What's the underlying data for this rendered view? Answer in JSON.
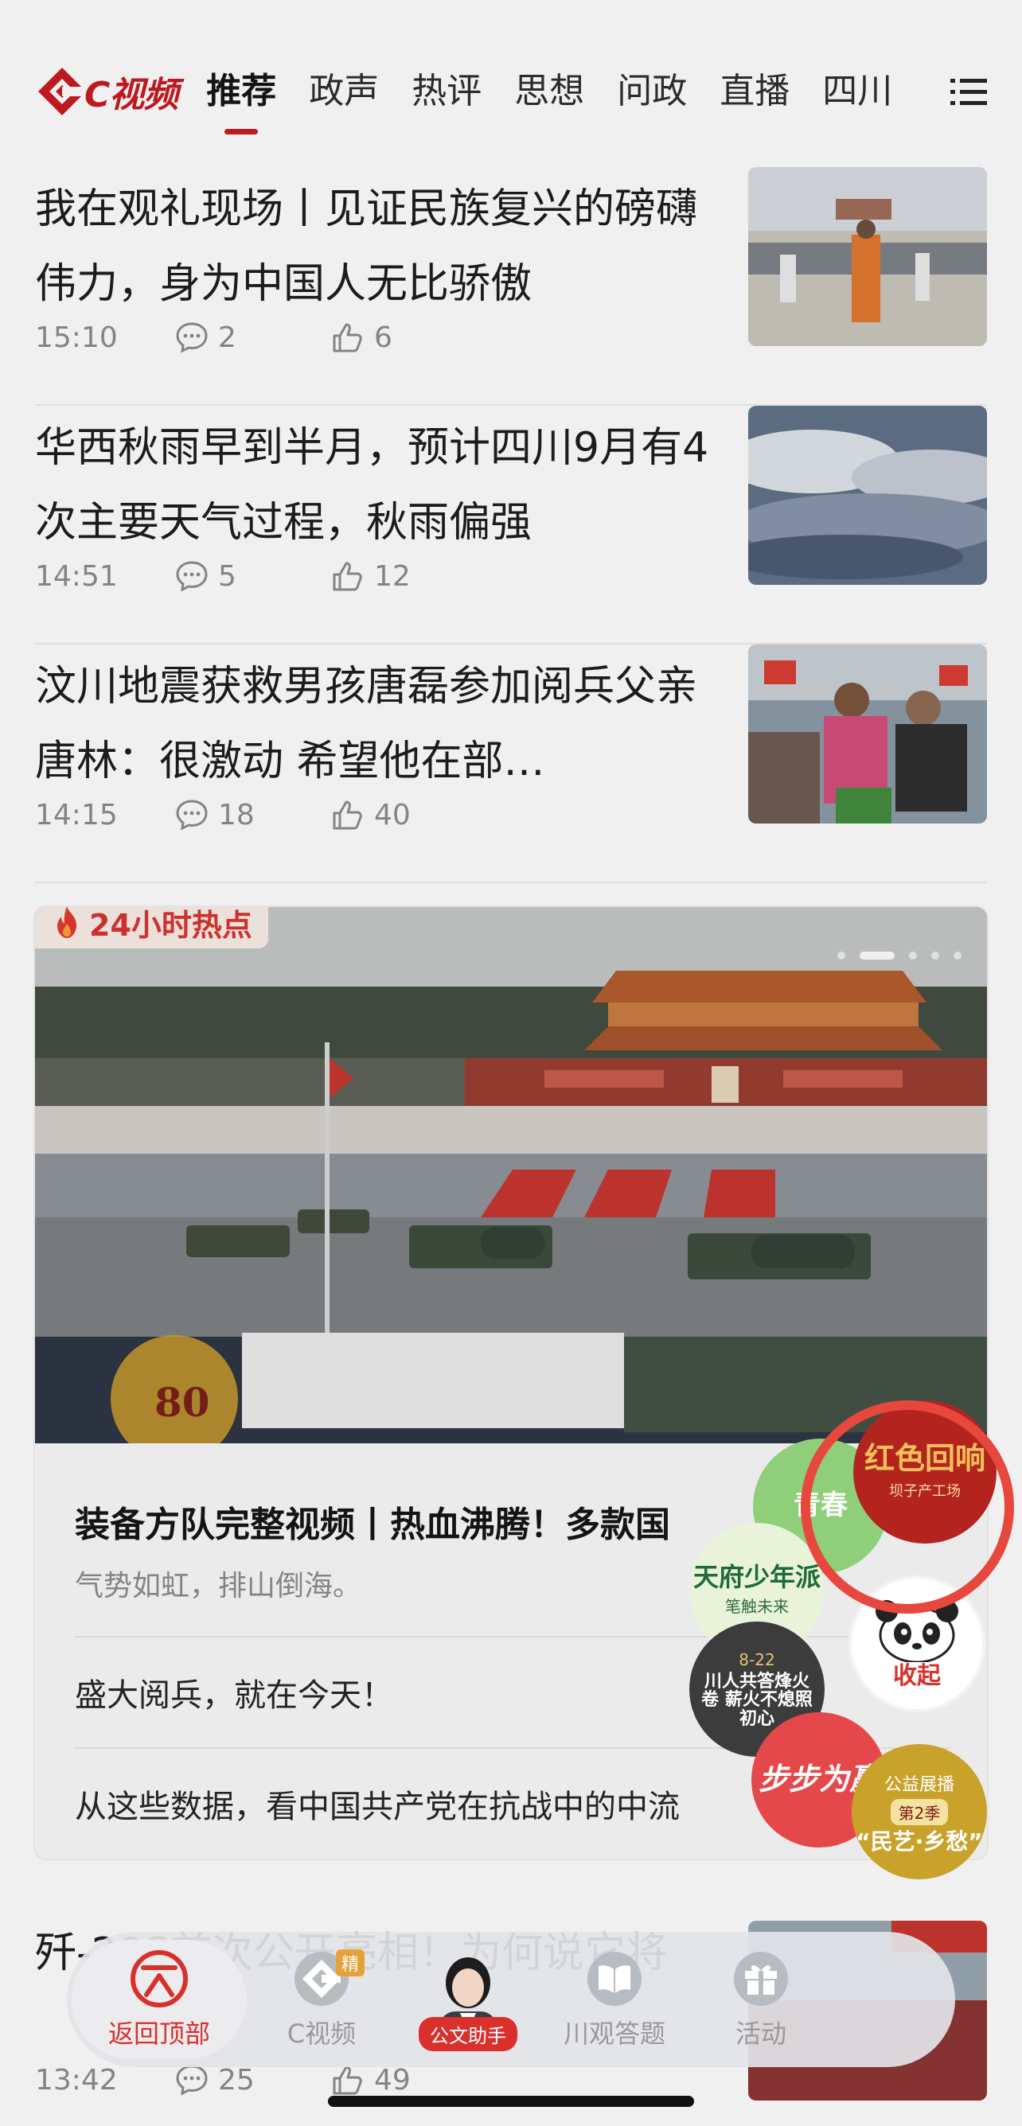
{
  "app": {
    "logo_text": "C视频",
    "brand_color": "#c8161d"
  },
  "nav": {
    "tabs": [
      "推荐",
      "政声",
      "热评",
      "思想",
      "问政",
      "直播",
      "四川"
    ],
    "active_tab": "推荐",
    "menu_icon": "menu-icon"
  },
  "news": [
    {
      "title": "我在观礼现场丨见证民族复兴的磅礴伟力，身为中国人无比骄傲",
      "time": "15:10",
      "comments": "2",
      "likes": "6"
    },
    {
      "title": "华西秋雨早到半月，预计四川9月有4次主要天气过程，秋雨偏强",
      "time": "14:51",
      "comments": "5",
      "likes": "12"
    },
    {
      "title": "汶川地震获救男孩唐磊参加阅兵父亲唐林：很激动 希望他在部…",
      "time": "14:15",
      "comments": "18",
      "likes": "40"
    }
  ],
  "hot": {
    "badge": "24小时热点",
    "lead_title": "装备方队完整视频丨热血沸腾！多款国",
    "lead_sub": "气势如虹，排山倒海。",
    "items": [
      "盛大阅兵，就在今天！",
      "从这些数据，看中国共产党在抗战中的中流"
    ]
  },
  "bottom_news": {
    "title": "歼-20S首次公开亮相！为何说它将",
    "time": "13:42",
    "comments": "25",
    "likes": "49"
  },
  "bubbles": {
    "red": "红色回响",
    "red_sub": "坝子产工场",
    "green": "青春",
    "youth": "天府少年派",
    "youth_sub": "笔触未来",
    "fire": "川人共答烽火卷 薪火不熄照初心",
    "fire_date": "8-22",
    "step": "步步为赢",
    "minyi_top": "公益展播",
    "minyi_season": "第2季",
    "minyi": "“民艺·乡愁”",
    "collapse": "收起"
  },
  "tabbar": {
    "items": [
      {
        "label": "返回顶部",
        "icon": "back-to-top-icon"
      },
      {
        "label": "C视频",
        "icon": "cvideo-icon",
        "badge": "精"
      },
      {
        "label": "公文助手",
        "icon": "assistant-avatar"
      },
      {
        "label": "川观答题",
        "icon": "book-icon"
      },
      {
        "label": "活动",
        "icon": "gift-icon"
      }
    ]
  }
}
